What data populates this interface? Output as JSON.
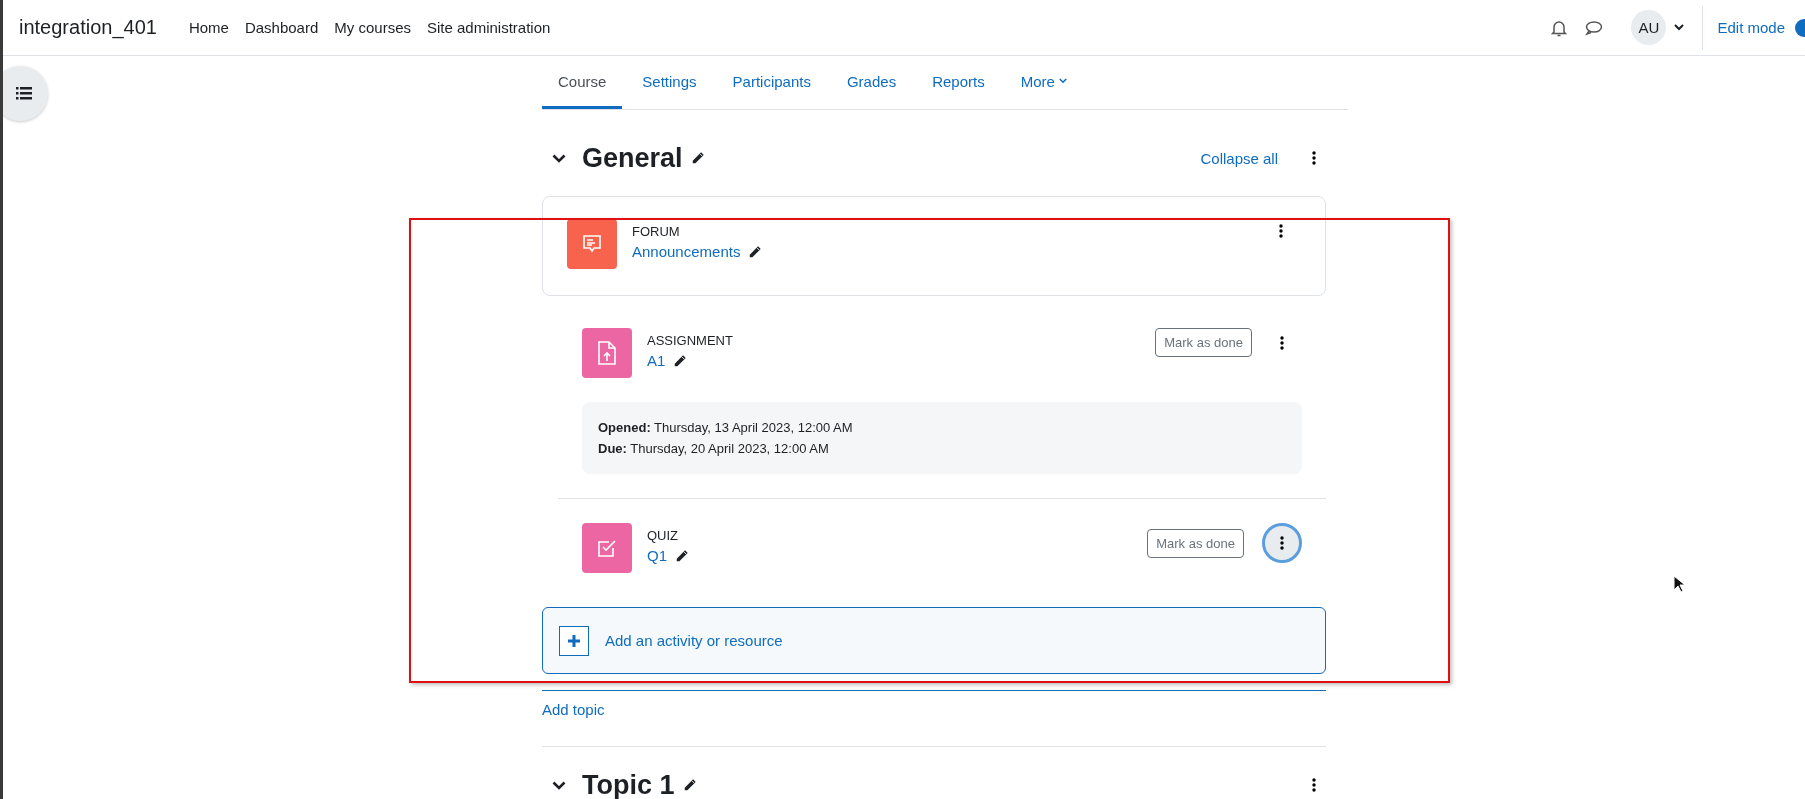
{
  "navbar": {
    "brand": "integration_401",
    "links": [
      "Home",
      "Dashboard",
      "My courses",
      "Site administration"
    ],
    "avatar": "AU",
    "edit_mode": {
      "label": "Edit mode",
      "on": true
    }
  },
  "tabs": [
    {
      "label": "Course",
      "selected": true
    },
    {
      "label": "Settings",
      "selected": false
    },
    {
      "label": "Participants",
      "selected": false
    },
    {
      "label": "Grades",
      "selected": false
    },
    {
      "label": "Reports",
      "selected": false
    },
    {
      "label": "More",
      "selected": false,
      "dropdown": true
    }
  ],
  "section": {
    "title": "General",
    "collapse_all": "Collapse all",
    "activities": [
      {
        "type": "FORUM",
        "kind": "forum",
        "name": "Announcements",
        "color": "#f7634d",
        "menu_focused": false
      },
      {
        "type": "ASSIGNMENT",
        "kind": "assignment",
        "name": "A1",
        "color": "#eb66a2",
        "completion_button": "Mark as done",
        "dates": [
          "**Opened:** Thursday, 13 April 2023, 12:00 AM",
          "**Due:** Thursday, 20 April 2023, 12:00 AM"
        ],
        "menu_focused": false
      },
      {
        "type": "QUIZ",
        "kind": "quiz",
        "name": "Q1",
        "color": "#eb66a2",
        "completion_button": "Mark as done",
        "menu_focused": true
      }
    ],
    "add_activity": "Add an activity or resource"
  },
  "add_topic": "Add topic",
  "next_section": {
    "title": "Topic 1"
  }
}
